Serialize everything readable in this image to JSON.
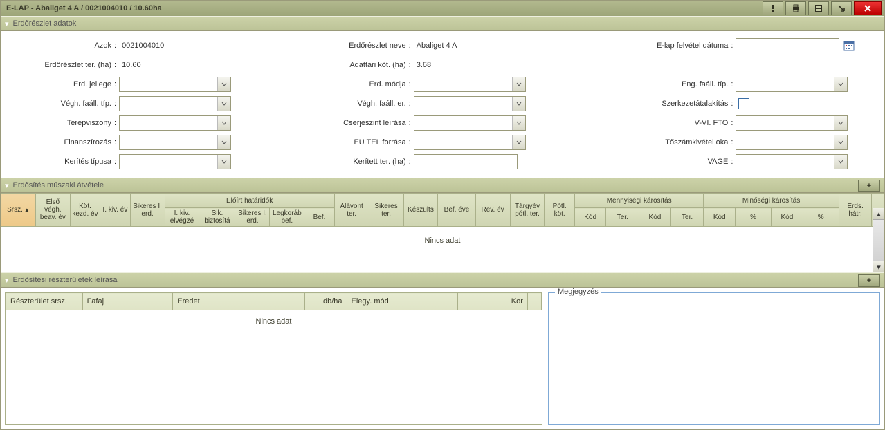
{
  "titlebar": {
    "text": "E-LAP - Abaliget 4 A / 0021004010 / 10.60ha"
  },
  "panels": {
    "p1_title": "Erdőrészlet adatok",
    "p2_title": "Erdősítés műszaki átvétele",
    "p3_title": "Erdősítési részterületek leírása"
  },
  "form": {
    "col1": {
      "r1_label": "Azok",
      "r1_value": "0021004010",
      "r2_label": "Erdőrészlet ter. (ha)",
      "r2_value": "10.60",
      "r3_label": "Erd. jellege",
      "r4_label": "Végh. faáll. típ.",
      "r5_label": "Terepviszony",
      "r6_label": "Finanszírozás",
      "r7_label": "Kerítés típusa"
    },
    "col2": {
      "r1_label": "Erdőrészlet neve",
      "r1_value": "Abaliget 4 A",
      "r2_label": "Adattári köt. (ha)",
      "r2_value": "3.68",
      "r3_label": "Erd. módja",
      "r4_label": "Végh. faáll. er.",
      "r5_label": "Cserjeszint leírása",
      "r6_label": "EU TEL forrása",
      "r7_label": "Kerített ter. (ha)"
    },
    "col3": {
      "r1_label": "E-lap felvétel dátuma",
      "r3_label": "Eng. faáll. típ.",
      "r4_label": "Szerkezetátalakítás",
      "r5_label": "V-VI. FTO",
      "r6_label": "Tőszámkivétel oka",
      "r7_label": "VAGE"
    }
  },
  "grid1": {
    "group_hatar": "Előírt határidők",
    "group_menny": "Mennyiségi károsítás",
    "group_minos": "Minőségi károsítás",
    "cols": {
      "srsz": "Srsz.",
      "elso": "Első végh. beav. év",
      "kot": "Köt. kezd. év",
      "ikiv": "I. kiv. év",
      "siker": "Sikeres I. erd.",
      "hi_ikiv": "I. kiv. elvégzé",
      "hi_sikb": "Sik. biztosítá",
      "hi_sik1": "Sikeres I. erd.",
      "hi_leg": "Legkoráb bef.",
      "hi_bef": "Bef.",
      "alavont": "Alávont ter.",
      "sikter": "Sikeres ter.",
      "keszult": "Készülts",
      "befeve": "Bef. éve",
      "revev": "Rev. év",
      "targyev": "Tárgyév pótl. ter.",
      "potlkot": "Pótl. köt.",
      "m_kod1": "Kód",
      "m_ter1": "Ter.",
      "m_kod2": "Kód",
      "m_ter2": "Ter.",
      "q_kod1": "Kód",
      "q_pc1": "%",
      "q_kod2": "Kód",
      "q_pc2": "%",
      "erdshatr": "Erds. hátr."
    },
    "nodata": "Nincs adat"
  },
  "grid2": {
    "cols": {
      "reszsrsz": "Részterület srsz.",
      "fafaj": "Fafaj",
      "eredet": "Eredet",
      "dbha": "db/ha",
      "elegy": "Elegy. mód",
      "kor": "Kor"
    },
    "nodata": "Nincs adat"
  },
  "note": {
    "legend": "Megjegyzés"
  },
  "icons": {
    "add": "+",
    "close": "X"
  }
}
